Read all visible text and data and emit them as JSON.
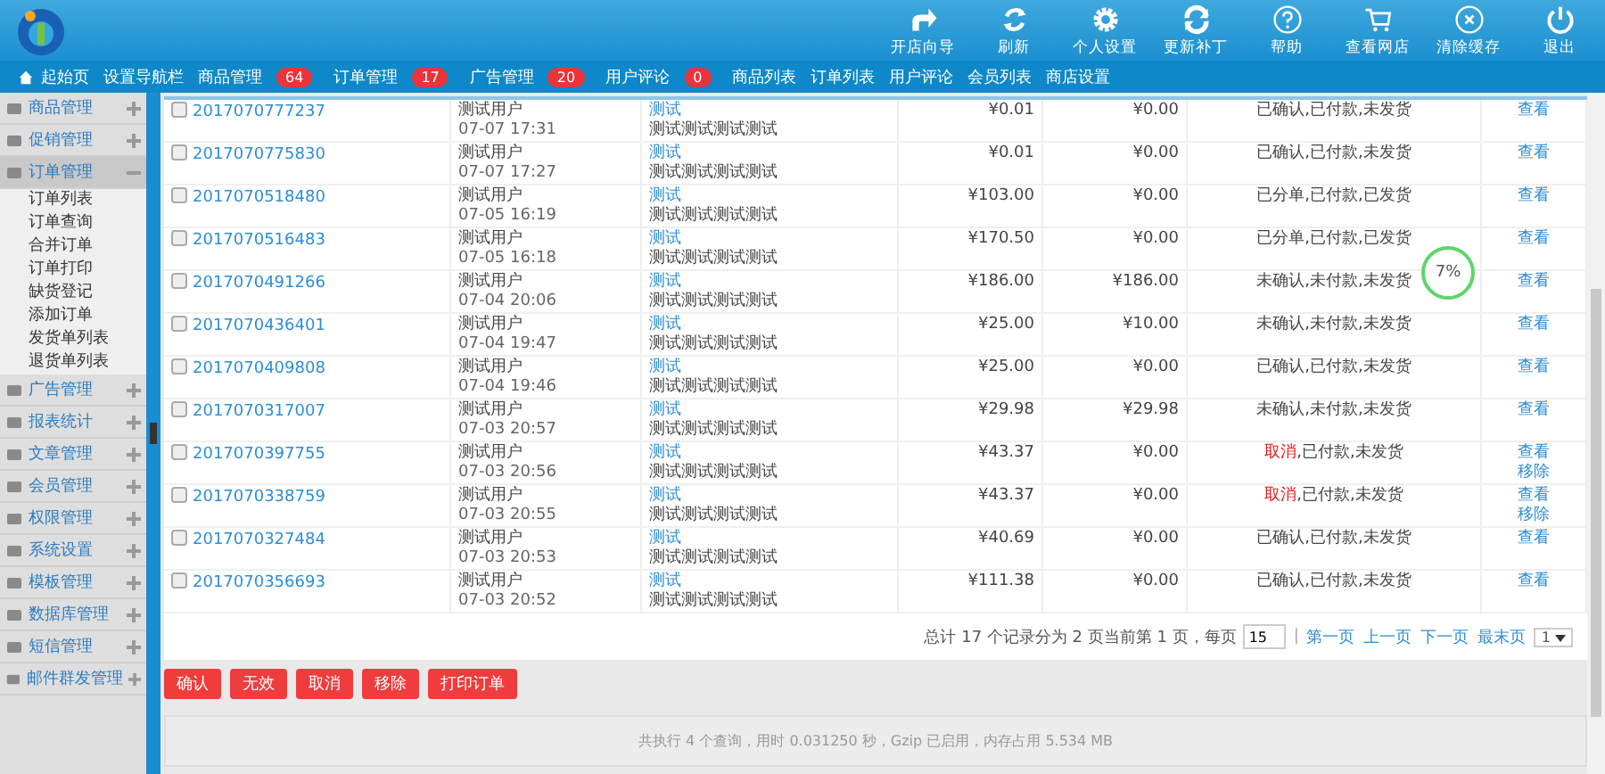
{
  "toolbar": [
    {
      "label": "开店向导"
    },
    {
      "label": "刷新"
    },
    {
      "label": "个人设置"
    },
    {
      "label": "更新补丁"
    },
    {
      "label": "帮助"
    },
    {
      "label": "查看网店"
    },
    {
      "label": "清除缓存"
    },
    {
      "label": "退出"
    }
  ],
  "nav": [
    {
      "label": "起始页"
    },
    {
      "label": "设置导航栏"
    },
    {
      "label": "商品管理",
      "badge": "64"
    },
    {
      "label": "订单管理",
      "badge": "17"
    },
    {
      "label": "广告管理",
      "badge": "20"
    },
    {
      "label": "用户评论",
      "badge": "0"
    },
    {
      "label": "商品列表"
    },
    {
      "label": "订单列表"
    },
    {
      "label": "用户评论"
    },
    {
      "label": "会员列表"
    },
    {
      "label": "商店设置"
    }
  ],
  "sidebar": [
    {
      "label": "商品管理",
      "expanded": false
    },
    {
      "label": "促销管理",
      "expanded": false
    },
    {
      "label": "订单管理",
      "expanded": true,
      "children": [
        "订单列表",
        "订单查询",
        "合并订单",
        "订单打印",
        "缺货登记",
        "添加订单",
        "发货单列表",
        "退货单列表"
      ]
    },
    {
      "label": "广告管理",
      "expanded": false
    },
    {
      "label": "报表统计",
      "expanded": false
    },
    {
      "label": "文章管理",
      "expanded": false
    },
    {
      "label": "会员管理",
      "expanded": false
    },
    {
      "label": "权限管理",
      "expanded": false
    },
    {
      "label": "系统设置",
      "expanded": false
    },
    {
      "label": "模板管理",
      "expanded": false
    },
    {
      "label": "数据库管理",
      "expanded": false
    },
    {
      "label": "短信管理",
      "expanded": false
    },
    {
      "label": "邮件群发管理",
      "expanded": false
    }
  ],
  "orders": [
    {
      "checked": false,
      "order_no": "2017070777237",
      "user": "测试用户",
      "time": "07-07 17:31",
      "consignee": "测试",
      "address": "测试测试测试测试",
      "total": "¥0.01",
      "paid": "¥0.00",
      "status_lead": "已确认",
      "status_lead_cancelled": false,
      "status_rest": ",已付款,未发货",
      "actions": [
        "查看"
      ]
    },
    {
      "checked": false,
      "order_no": "2017070775830",
      "user": "测试用户",
      "time": "07-07 17:27",
      "consignee": "测试",
      "address": "测试测试测试测试",
      "total": "¥0.01",
      "paid": "¥0.00",
      "status_lead": "已确认",
      "status_lead_cancelled": false,
      "status_rest": ",已付款,未发货",
      "actions": [
        "查看"
      ]
    },
    {
      "checked": false,
      "order_no": "2017070518480",
      "user": "测试用户",
      "time": "07-05 16:19",
      "consignee": "测试",
      "address": "测试测试测试测试",
      "total": "¥103.00",
      "paid": "¥0.00",
      "status_lead": "已分单",
      "status_lead_cancelled": false,
      "status_rest": ",已付款,已发货",
      "actions": [
        "查看"
      ]
    },
    {
      "checked": false,
      "order_no": "2017070516483",
      "user": "测试用户",
      "time": "07-05 16:18",
      "consignee": "测试",
      "address": "测试测试测试测试",
      "total": "¥170.50",
      "paid": "¥0.00",
      "status_lead": "已分单",
      "status_lead_cancelled": false,
      "status_rest": ",已付款,已发货",
      "actions": [
        "查看"
      ]
    },
    {
      "checked": false,
      "order_no": "2017070491266",
      "user": "测试用户",
      "time": "07-04 20:06",
      "consignee": "测试",
      "address": "测试测试测试测试",
      "total": "¥186.00",
      "paid": "¥186.00",
      "status_lead": "未确认",
      "status_lead_cancelled": false,
      "status_rest": ",未付款,未发货",
      "actions": [
        "查看"
      ]
    },
    {
      "checked": false,
      "order_no": "2017070436401",
      "user": "测试用户",
      "time": "07-04 19:47",
      "consignee": "测试",
      "address": "测试测试测试测试",
      "total": "¥25.00",
      "paid": "¥10.00",
      "status_lead": "未确认",
      "status_lead_cancelled": false,
      "status_rest": ",未付款,未发货",
      "actions": [
        "查看"
      ]
    },
    {
      "checked": false,
      "order_no": "2017070409808",
      "user": "测试用户",
      "time": "07-04 19:46",
      "consignee": "测试",
      "address": "测试测试测试测试",
      "total": "¥25.00",
      "paid": "¥0.00",
      "status_lead": "已确认",
      "status_lead_cancelled": false,
      "status_rest": ",已付款,未发货",
      "actions": [
        "查看"
      ]
    },
    {
      "checked": false,
      "order_no": "2017070317007",
      "user": "测试用户",
      "time": "07-03 20:57",
      "consignee": "测试",
      "address": "测试测试测试测试",
      "total": "¥29.98",
      "paid": "¥29.98",
      "status_lead": "未确认",
      "status_lead_cancelled": false,
      "status_rest": ",未付款,未发货",
      "actions": [
        "查看"
      ]
    },
    {
      "checked": false,
      "order_no": "2017070397755",
      "user": "测试用户",
      "time": "07-03 20:56",
      "consignee": "测试",
      "address": "测试测试测试测试",
      "total": "¥43.37",
      "paid": "¥0.00",
      "status_lead": "取消",
      "status_lead_cancelled": true,
      "status_rest": ",已付款,未发货",
      "actions": [
        "查看",
        "移除"
      ]
    },
    {
      "checked": false,
      "order_no": "2017070338759",
      "user": "测试用户",
      "time": "07-03 20:55",
      "consignee": "测试",
      "address": "测试测试测试测试",
      "total": "¥43.37",
      "paid": "¥0.00",
      "status_lead": "取消",
      "status_lead_cancelled": true,
      "status_rest": ",已付款,未发货",
      "actions": [
        "查看",
        "移除"
      ]
    },
    {
      "checked": false,
      "order_no": "2017070327484",
      "user": "测试用户",
      "time": "07-03 20:53",
      "consignee": "测试",
      "address": "测试测试测试测试",
      "total": "¥40.69",
      "paid": "¥0.00",
      "status_lead": "已确认",
      "status_lead_cancelled": false,
      "status_rest": ",已付款,未发货",
      "actions": [
        "查看"
      ]
    },
    {
      "checked": false,
      "order_no": "2017070356693",
      "user": "测试用户",
      "time": "07-03 20:52",
      "consignee": "测试",
      "address": "测试测试测试测试",
      "total": "¥111.38",
      "paid": "¥0.00",
      "status_lead": "已确认",
      "status_lead_cancelled": false,
      "status_rest": ",已付款,未发货",
      "actions": [
        "查看"
      ]
    }
  ],
  "speed_badge": "7%",
  "pagination": {
    "summary": "总计 17 个记录分为 2 页当前第 1 页，每页",
    "page_size": "15",
    "separator": "|",
    "links": [
      "第一页",
      "上一页",
      "下一页",
      "最末页"
    ],
    "page": "1"
  },
  "buttons": [
    "确认",
    "无效",
    "取消",
    "移除",
    "打印订单"
  ],
  "footer": "共执行 4 个查询，用时 0.031250 秒，Gzip 已启用，内存占用 5.534 MB"
}
